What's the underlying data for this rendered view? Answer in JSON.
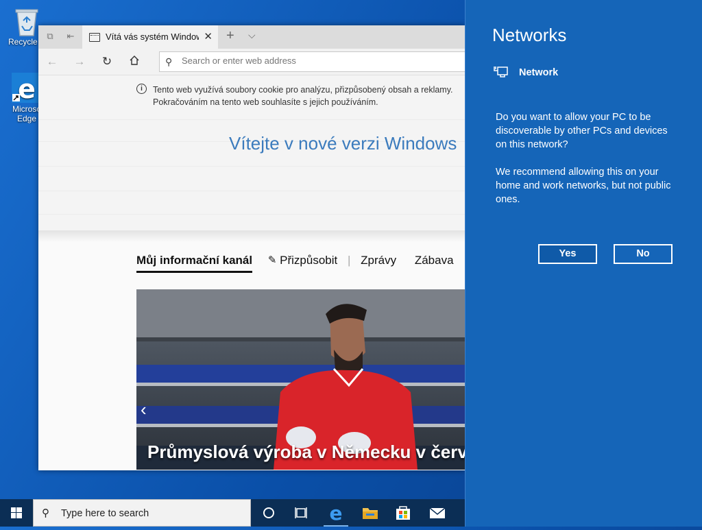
{
  "desktop": {
    "icons": [
      {
        "name": "Recycle Bin",
        "label": "Recycle B"
      },
      {
        "name": "Microsoft Edge",
        "label_line1": "Microso",
        "label_line2": "Edge"
      }
    ]
  },
  "browser": {
    "tab_title": "Vítá vás systém Windows",
    "address_placeholder": "Search or enter web address",
    "cookie_line1": "Tento web využívá soubory cookie pro analýzu, přizpůsobený obsah a reklamy.",
    "cookie_line2": "Pokračováním na tento web souhlasíte s jejich používáním.",
    "welcome": "Vítejte v nové verzi Windows",
    "feed_tabs": {
      "active": "Můj informační kanál",
      "customize": "Přizpůsobit",
      "separator": "|",
      "news": "Zprávy",
      "entertainment": "Zábava"
    },
    "hero_caption": "Průmyslová výroba v Německu v červ"
  },
  "networks": {
    "title": "Networks",
    "network_name": "Network",
    "question": "Do you want to allow your PC to be discoverable by other PCs and devices on this network?",
    "recommendation": "We recommend allowing this on your home and work networks, but not public ones.",
    "yes_label": "Yes",
    "no_label": "No"
  },
  "taskbar": {
    "search_placeholder": "Type here to search",
    "pinned": [
      "cortana-icon",
      "task-view-icon",
      "edge-icon",
      "file-explorer-icon",
      "store-icon",
      "mail-icon"
    ]
  },
  "colors": {
    "flyout_bg": "#1565b8",
    "taskbar_bg": "#0b2e55",
    "accent_text": "#3b7bbd"
  }
}
